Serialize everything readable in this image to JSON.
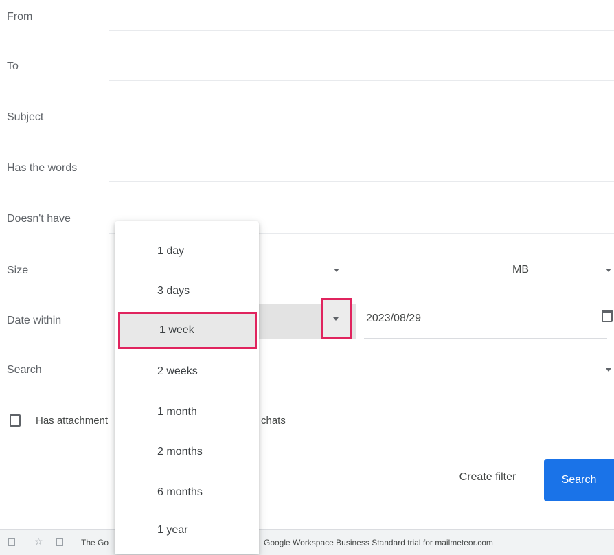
{
  "fields": {
    "from": "From",
    "to": "To",
    "subject": "Subject",
    "has_words": "Has the words",
    "doesnt_have": "Doesn't have",
    "size": "Size",
    "date_within": "Date within",
    "search": "Search"
  },
  "size": {
    "unit": "MB"
  },
  "date": {
    "value": "2023/08/29"
  },
  "attachments": {
    "label": "Has attachment",
    "chats_label": "chats",
    "checked": false
  },
  "actions": {
    "create_filter": "Create filter",
    "search": "Search"
  },
  "dropdown": {
    "options": [
      "1 day",
      "3 days",
      "1 week",
      "2 weeks",
      "1 month",
      "2 months",
      "6 months",
      "1 year"
    ],
    "selected": "1 week"
  },
  "email_row": {
    "sender": "The Go",
    "subject": "Google Workspace Business Standard trial for mailmeteor.com"
  },
  "colors": {
    "highlight": "#e0245e",
    "primary_button": "#1a73e8"
  }
}
